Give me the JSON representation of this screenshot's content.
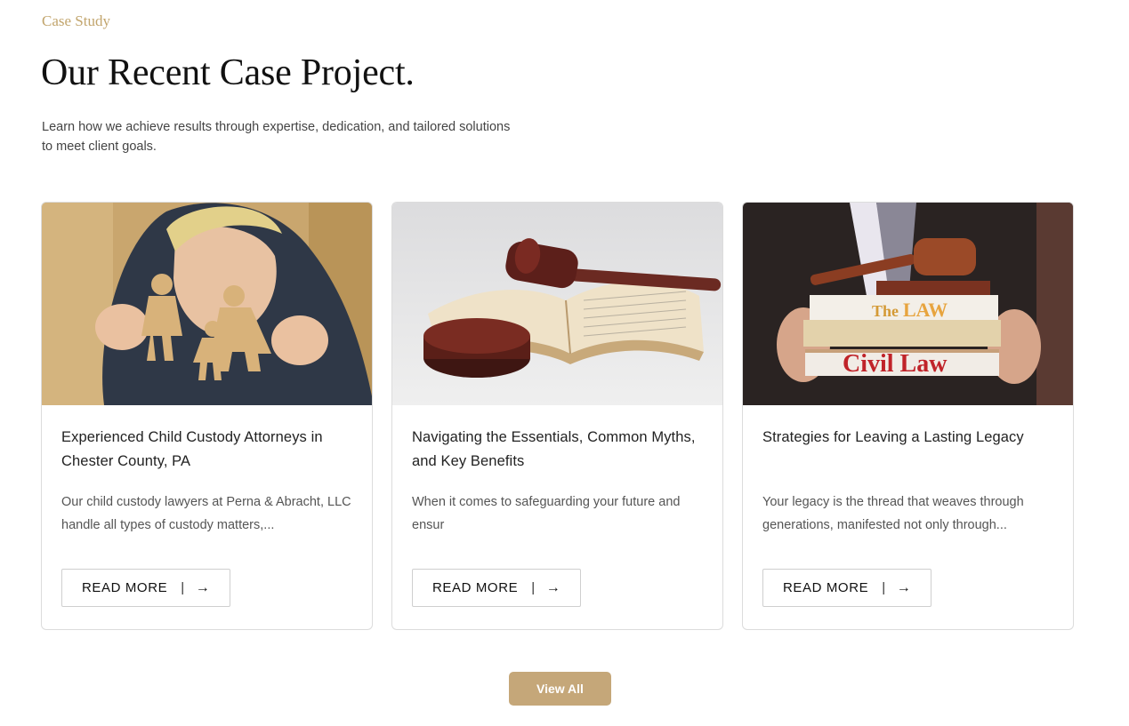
{
  "section": {
    "eyebrow": "Case Study",
    "title": "Our Recent Case Project.",
    "intro": "Learn how we achieve results through expertise, dedication, and tailored solutions to meet client goals."
  },
  "cards": [
    {
      "title": "Experienced Child Custody Attorneys in Chester County, PA",
      "excerpt": "Our child custody lawyers at Perna & Abracht, LLC handle all types of custody matters,...",
      "button_label": "READ MORE",
      "separator": "|",
      "arrow": "→"
    },
    {
      "title": "Navigating the Essentials, Common Myths, and Key Benefits",
      "excerpt": "When it comes to safeguarding your future and ensur",
      "button_label": "READ MORE",
      "separator": "|",
      "arrow": "→"
    },
    {
      "title": "Strategies for Leaving a Lasting Legacy",
      "excerpt": "Your legacy is the thread that weaves through generations, manifested not only through...",
      "button_label": "READ MORE",
      "separator": "|",
      "arrow": "→",
      "image_text": {
        "book_top_the": "The",
        "book_top_law": "LAW",
        "book_bottom": "Civil Law"
      }
    }
  ],
  "view_all": "View All",
  "colors": {
    "accent": "#c2a56d",
    "button": "#c5a779"
  }
}
